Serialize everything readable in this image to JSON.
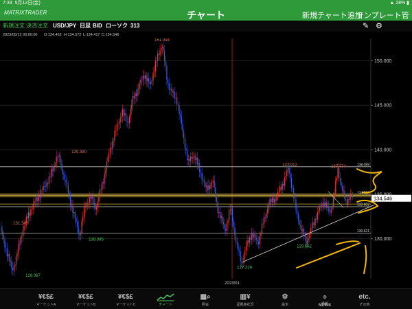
{
  "status": {
    "time": "7:33",
    "date": "5月12日(金)",
    "battery": "28%"
  },
  "header": {
    "logo": "MATRIXTRADER",
    "title": "チャート",
    "new_chart": "新規チャート追加",
    "template": "テンプレート管理"
  },
  "toolbar": {
    "new_order": "新規注文",
    "settle_order": "決済注文",
    "pair": "USD/JPY",
    "period": "日足",
    "price_type": "BID",
    "chart_style": "ローソク",
    "bar_count": "313",
    "pencil_icon": "pencil-icon",
    "gear_icon": "gear-icon"
  },
  "ohlc": {
    "date": "2023/05/12 00:00:00",
    "open": "O:134.462",
    "high": "H:134.572",
    "low": "L:134.417",
    "close": "C:134.546"
  },
  "chart_data": {
    "type": "candlestick",
    "pair": "USD/JPY",
    "ylim": [
      125.5,
      152.5
    ],
    "y_ticks": [
      "150.000",
      "145.000",
      "140.000",
      "135.000",
      "130.000"
    ],
    "x_label": "2023/01",
    "markers": {
      "high_labels": [
        "151.944",
        "139.390",
        "137.912",
        "137.774",
        "131.348"
      ],
      "low_labels": [
        "126.367",
        "130.395",
        "127.219",
        "129.642"
      ]
    },
    "level_lines": [
      "138.089",
      "134.893",
      "133.602",
      "130.621"
    ],
    "current_price": "134.546",
    "path": [
      [
        0,
        131.3
      ],
      [
        10,
        128.5
      ],
      [
        18,
        126.4
      ],
      [
        24,
        128.0
      ],
      [
        34,
        131.3
      ],
      [
        46,
        133.5
      ],
      [
        58,
        135.0
      ],
      [
        72,
        136.8
      ],
      [
        84,
        139.4
      ],
      [
        92,
        137.5
      ],
      [
        100,
        135.0
      ],
      [
        110,
        132.0
      ],
      [
        116,
        130.4
      ],
      [
        124,
        133.8
      ],
      [
        132,
        134.6
      ],
      [
        140,
        133.5
      ],
      [
        150,
        136.5
      ],
      [
        160,
        140.0
      ],
      [
        170,
        142.5
      ],
      [
        178,
        144.3
      ],
      [
        186,
        143.0
      ],
      [
        194,
        145.8
      ],
      [
        202,
        147.0
      ],
      [
        210,
        148.5
      ],
      [
        218,
        147.2
      ],
      [
        226,
        149.5
      ],
      [
        236,
        151.94
      ],
      [
        244,
        147.5
      ],
      [
        250,
        146.5
      ],
      [
        258,
        145.5
      ],
      [
        266,
        142.0
      ],
      [
        274,
        138.5
      ],
      [
        282,
        139.5
      ],
      [
        292,
        137.5
      ],
      [
        300,
        135.5
      ],
      [
        310,
        136.5
      ],
      [
        318,
        133.0
      ],
      [
        328,
        131.0
      ],
      [
        336,
        133.5
      ],
      [
        344,
        129.5
      ],
      [
        352,
        127.22
      ],
      [
        360,
        129.5
      ],
      [
        366,
        130.5
      ],
      [
        376,
        129.6
      ],
      [
        384,
        132.0
      ],
      [
        392,
        134.0
      ],
      [
        402,
        134.6
      ],
      [
        412,
        136.2
      ],
      [
        420,
        137.91
      ],
      [
        426,
        135.5
      ],
      [
        432,
        132.8
      ],
      [
        440,
        130.8
      ],
      [
        446,
        129.64
      ],
      [
        454,
        131.2
      ],
      [
        462,
        132.8
      ],
      [
        472,
        134.2
      ],
      [
        480,
        132.8
      ],
      [
        486,
        134.6
      ],
      [
        492,
        137.77
      ],
      [
        498,
        135.6
      ],
      [
        504,
        134.0
      ],
      [
        510,
        134.9
      ],
      [
        515,
        134.5
      ]
    ]
  },
  "tabs": [
    {
      "icon": "¥€$£",
      "label": "マーケットA"
    },
    {
      "icon": "¥€$£",
      "label": "マーケットB"
    },
    {
      "icon": "¥€$£",
      "label": "マーケットC"
    },
    {
      "icon": "chart-icon",
      "label": "チャート"
    },
    {
      "icon": "search-icon",
      "label": "照会"
    },
    {
      "icon": "¥",
      "label": "証拠金状況"
    },
    {
      "icon": "gear-icon",
      "label": "設定"
    },
    {
      "icon": "NEWS",
      "label": "情報"
    },
    {
      "icon": "etc.",
      "label": "その他"
    }
  ]
}
